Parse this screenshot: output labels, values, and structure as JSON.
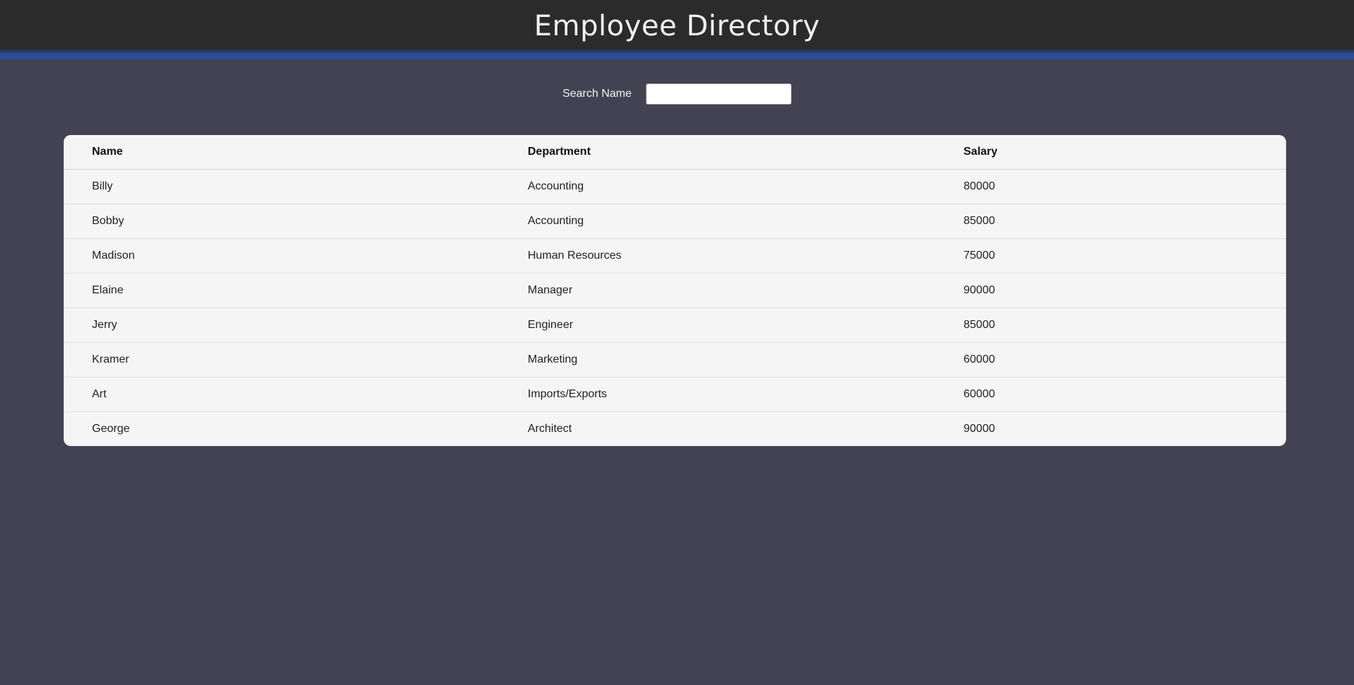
{
  "header": {
    "title": "Employee Directory"
  },
  "search": {
    "label": "Search Name",
    "value": "",
    "placeholder": ""
  },
  "table": {
    "columns": [
      "Name",
      "Department",
      "Salary"
    ],
    "rows": [
      {
        "name": "Billy",
        "department": "Accounting",
        "salary": "80000"
      },
      {
        "name": "Bobby",
        "department": "Accounting",
        "salary": "85000"
      },
      {
        "name": "Madison",
        "department": "Human Resources",
        "salary": "75000"
      },
      {
        "name": "Elaine",
        "department": "Manager",
        "salary": "90000"
      },
      {
        "name": "Jerry",
        "department": "Engineer",
        "salary": "85000"
      },
      {
        "name": "Kramer",
        "department": "Marketing",
        "salary": "60000"
      },
      {
        "name": "Art",
        "department": "Imports/Exports",
        "salary": "60000"
      },
      {
        "name": "George",
        "department": "Architect",
        "salary": "90000"
      }
    ]
  },
  "colors": {
    "header_bg": "#2b2b2b",
    "accent_bar": "#2f4b8f",
    "page_bg": "#434252",
    "table_bg": "#f5f5f5"
  }
}
